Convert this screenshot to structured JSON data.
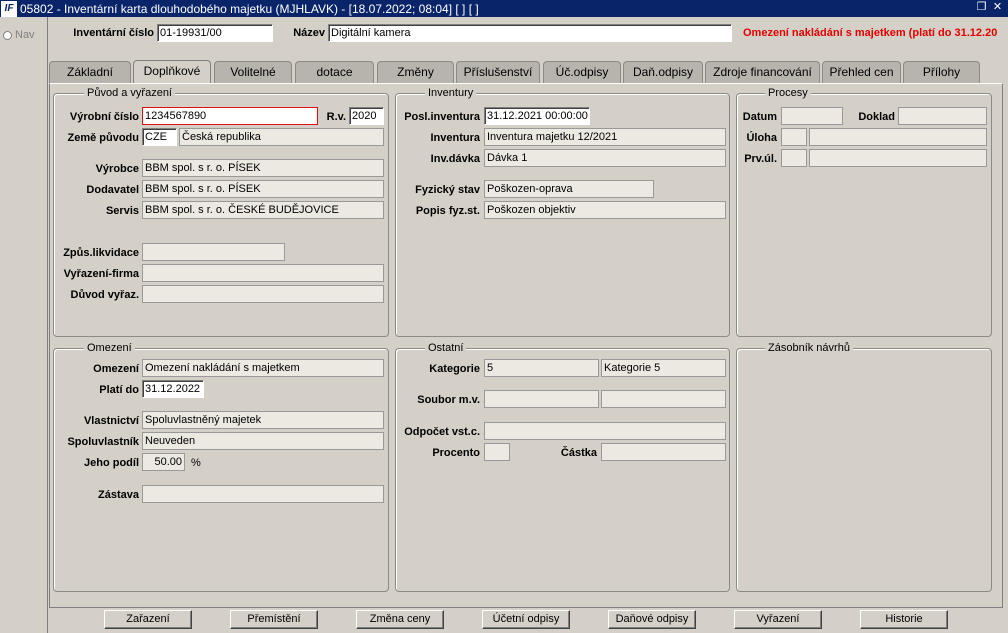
{
  "window": {
    "title": "05802 - Inventární karta dlouhodobého majetku (MJHLAVK) - [18.07.2022; 08:04]  [ ]  [ ]",
    "icon": "app-logo"
  },
  "nav": {
    "label": "Nav"
  },
  "header": {
    "inv_label": "Inventární číslo",
    "inv_value": "01-19931/00",
    "name_label": "Název",
    "name_value": "Digitální kamera",
    "warning": "Omezení nakládání s majetkem (platí do 31.12.20"
  },
  "tabs": [
    {
      "label": "Základní"
    },
    {
      "label": "Doplňkové"
    },
    {
      "label": "Volitelné"
    },
    {
      "label": "dotace"
    },
    {
      "label": "Změny"
    },
    {
      "label": "Příslušenství"
    },
    {
      "label": "Úč.odpisy"
    },
    {
      "label": "Daň.odpisy"
    },
    {
      "label": "Zdroje financování"
    },
    {
      "label": "Přehled cen"
    },
    {
      "label": "Přílohy"
    }
  ],
  "puvod": {
    "title": "Původ a vyřazení",
    "vyrobni_label": "Výrobní číslo",
    "vyrobni_value": "1234567890",
    "rv_label": "R.v.",
    "rv_value": "2020",
    "zeme_label": "Země původu",
    "zeme_code": "CZE",
    "zeme_name": "Česká republika",
    "vyrobce_label": "Výrobce",
    "vyrobce_value": "BBM spol. s r. o.  PÍSEK",
    "dodavatel_label": "Dodavatel",
    "dodavatel_value": "BBM spol. s r. o.  PÍSEK",
    "servis_label": "Servis",
    "servis_value": "BBM spol. s r. o.  ČESKÉ BUDĚJOVICE",
    "likvidace_label": "Způs.likvidace",
    "likvidace_value": "",
    "firma_label": "Vyřazení-firma",
    "firma_value": "",
    "duvod_label": "Důvod vyřaz.",
    "duvod_value": ""
  },
  "inventury": {
    "title": "Inventury",
    "posl_label": "Posl.inventura",
    "posl_value": "31.12.2021 00:00:00",
    "inv_label": "Inventura",
    "inv_value": "Inventura majetku 12/2021",
    "davka_label": "Inv.dávka",
    "davka_value": "Dávka 1",
    "stav_label": "Fyzický stav",
    "stav_value": "Poškozen-oprava",
    "popis_label": "Popis fyz.st.",
    "popis_value": "Poškozen objektiv"
  },
  "procesy": {
    "title": "Procesy",
    "datum_label": "Datum",
    "doklad_label": "Doklad",
    "uloha_label": "Úloha",
    "prvul_label": "Prv.úl."
  },
  "omezeni": {
    "title": "Omezení",
    "omezeni_label": "Omezení",
    "omezeni_value": "Omezení nakládání s majetkem",
    "plati_label": "Platí do",
    "plati_value": "31.12.2022",
    "vlastnictvi_label": "Vlastnictví",
    "vlastnictvi_value": "Spoluvlastněný majetek",
    "spoluvl_label": "Spoluvlastník",
    "spoluvl_value": "Neuveden",
    "podil_label": "Jeho podíl",
    "podil_value": "50.00",
    "podil_unit": "%",
    "zastava_label": "Zástava",
    "zastava_value": ""
  },
  "ostatni": {
    "title": "Ostatní",
    "kategorie_label": "Kategorie",
    "kategorie_code": "5",
    "kategorie_name": "Kategorie 5",
    "soubor_label": "Soubor m.v.",
    "odpocet_label": "Odpočet vst.c.",
    "procento_label": "Procento",
    "castka_label": "Částka"
  },
  "zasobnik": {
    "title": "Zásobník návrhů"
  },
  "buttons": [
    {
      "label": "Zařazení"
    },
    {
      "label": "Přemístění"
    },
    {
      "label": "Změna ceny"
    },
    {
      "label": "Účetní odpisy"
    },
    {
      "label": "Daňové odpisy"
    },
    {
      "label": "Vyřazení"
    },
    {
      "label": "Historie"
    }
  ]
}
